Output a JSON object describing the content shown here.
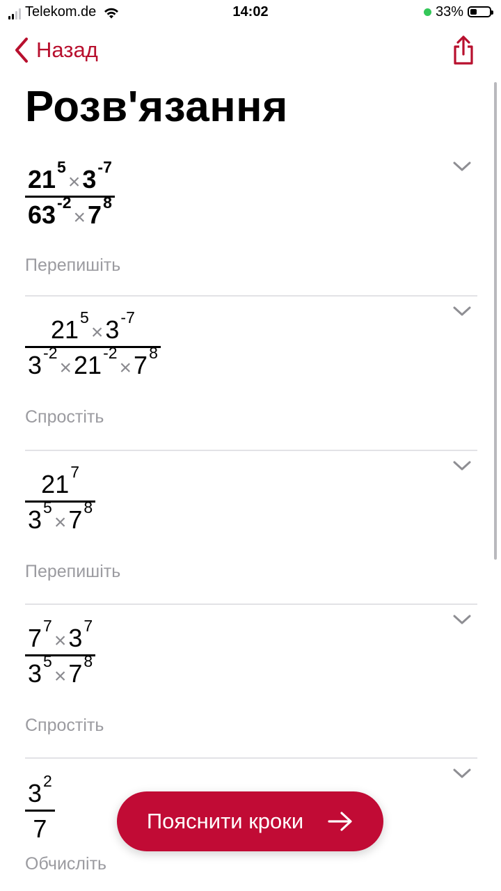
{
  "status_bar": {
    "carrier": "Telekom.de",
    "time": "14:02",
    "battery": "33%",
    "battery_level": 0.33
  },
  "nav": {
    "back_label": "Назад"
  },
  "page_title": "Розв'язання",
  "steps": [
    {
      "label": "Перепишіть",
      "numerator": [
        {
          "base": "21",
          "exp": "5"
        },
        {
          "base": "3",
          "exp": "-7"
        }
      ],
      "denominator": [
        {
          "base": "63",
          "exp": "-2"
        },
        {
          "base": "7",
          "exp": "8"
        }
      ]
    },
    {
      "label": "Спростіть",
      "numerator": [
        {
          "base": "21",
          "exp": "5"
        },
        {
          "base": "3",
          "exp": "-7"
        }
      ],
      "denominator": [
        {
          "base": "3",
          "exp": "-2"
        },
        {
          "base": "21",
          "exp": "-2"
        },
        {
          "base": "7",
          "exp": "8"
        }
      ]
    },
    {
      "label": "Перепишіть",
      "numerator": [
        {
          "base": "21",
          "exp": "7"
        }
      ],
      "denominator": [
        {
          "base": "3",
          "exp": "5"
        },
        {
          "base": "7",
          "exp": "8"
        }
      ]
    },
    {
      "label": "Спростіть",
      "numerator": [
        {
          "base": "7",
          "exp": "7"
        },
        {
          "base": "3",
          "exp": "7"
        }
      ],
      "denominator": [
        {
          "base": "3",
          "exp": "5"
        },
        {
          "base": "7",
          "exp": "8"
        }
      ]
    },
    {
      "label": "Обчисліть",
      "numerator": [
        {
          "base": "3",
          "exp": "2"
        }
      ],
      "denominator": [
        {
          "base": "7",
          "exp": ""
        }
      ]
    }
  ],
  "multiply_symbol": "×",
  "explain_button": {
    "label": "Пояснити кроки"
  },
  "colors": {
    "accent": "#b8102e",
    "button": "#c10b35",
    "muted": "#9b9ba0",
    "divider": "#e2e2e6"
  },
  "icons": [
    "back-chevron-icon",
    "share-icon",
    "chevron-down-icon",
    "arrow-right-icon",
    "wifi-icon",
    "signal-icon",
    "battery-icon"
  ]
}
